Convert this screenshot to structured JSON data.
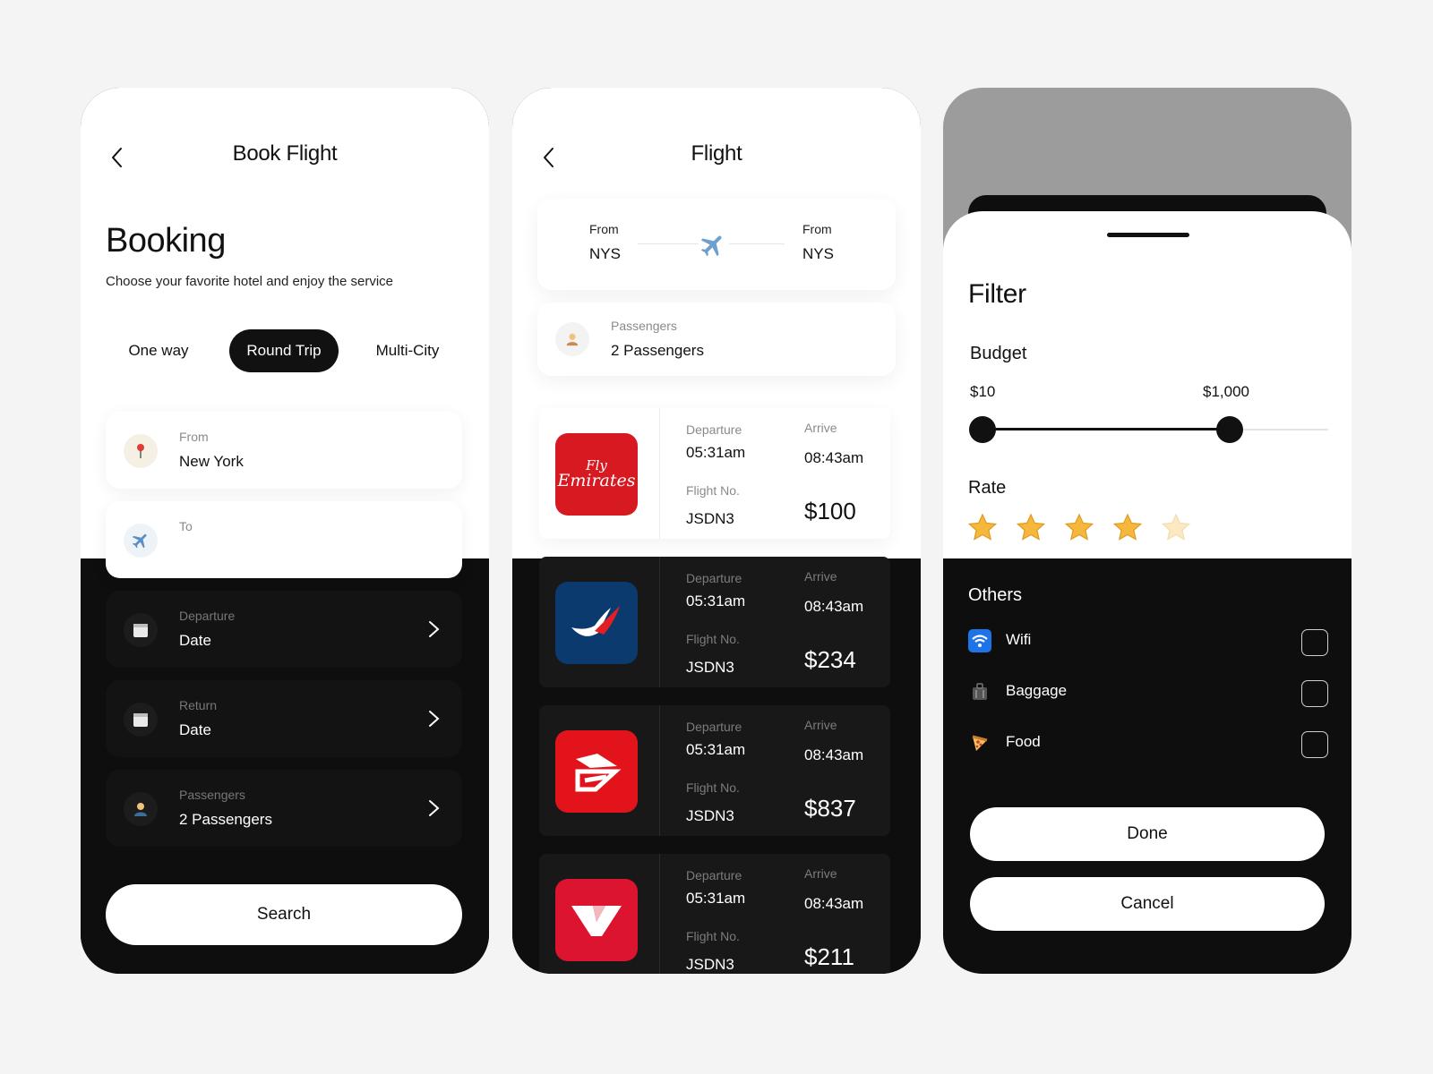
{
  "screen1": {
    "header_title": "Book Flight",
    "heading": "Booking",
    "subtitle": "Choose your favorite hotel and enjoy the service",
    "trip_types": [
      "One way",
      "Round Trip",
      "Multi-City"
    ],
    "selected_trip_type": "Round Trip",
    "fields": {
      "from": {
        "label": "From",
        "value": "New York",
        "icon": "pin-icon"
      },
      "to": {
        "label": "To",
        "value": "",
        "icon": "airplane-icon"
      },
      "departure": {
        "label": "Departure",
        "value": "Date",
        "icon": "calendar-icon"
      },
      "return": {
        "label": "Return",
        "value": "Date",
        "icon": "calendar-icon"
      },
      "passengers": {
        "label": "Passengers",
        "value": "2 Passengers",
        "icon": "person-icon"
      }
    },
    "search_label": "Search"
  },
  "screen2": {
    "header_title": "Flight",
    "route": {
      "from_label": "From",
      "from_code": "NYS",
      "to_label": "From",
      "to_code": "NYS"
    },
    "passengers": {
      "label": "Passengers",
      "value": "2 Passengers"
    },
    "labels": {
      "departure": "Departure",
      "arrive": "Arrive",
      "flight_no": "Flight No."
    },
    "flights": [
      {
        "airline_logo_text": [
          "Fly",
          "Emirates"
        ],
        "logo_color": "#d71921",
        "departure": "05:31am",
        "arrive": "08:43am",
        "flight_no": "JSDN3",
        "price": "$100"
      },
      {
        "airline_logo_text": [],
        "logo_color": "#0b3a6e",
        "departure": "05:31am",
        "arrive": "08:43am",
        "flight_no": "JSDN3",
        "price": "$234"
      },
      {
        "airline_logo_text": [],
        "logo_color": "#e3131b",
        "departure": "05:31am",
        "arrive": "08:43am",
        "flight_no": "JSDN3",
        "price": "$837"
      },
      {
        "airline_logo_text": [],
        "logo_color": "#dd1430",
        "departure": "05:31am",
        "arrive": "08:43am",
        "flight_no": "JSDN3",
        "price": "$211"
      }
    ]
  },
  "screen3": {
    "title": "Filter",
    "budget": {
      "label": "Budget",
      "min_label": "$10",
      "max_label": "$1,000"
    },
    "rate": {
      "label": "Rate",
      "value": 4,
      "max": 5
    },
    "others": {
      "label": "Others",
      "items": [
        {
          "label": "Wifi",
          "icon": "wifi-icon",
          "checked": false
        },
        {
          "label": "Baggage",
          "icon": "baggage-icon",
          "checked": false
        },
        {
          "label": "Food",
          "icon": "pizza-icon",
          "checked": false
        }
      ]
    },
    "done_label": "Done",
    "cancel_label": "Cancel"
  },
  "colors": {
    "accent": "#111111",
    "page_bg": "#f4f4f4",
    "dark_bg": "#0e0e0e",
    "star": "#f5b83c"
  }
}
